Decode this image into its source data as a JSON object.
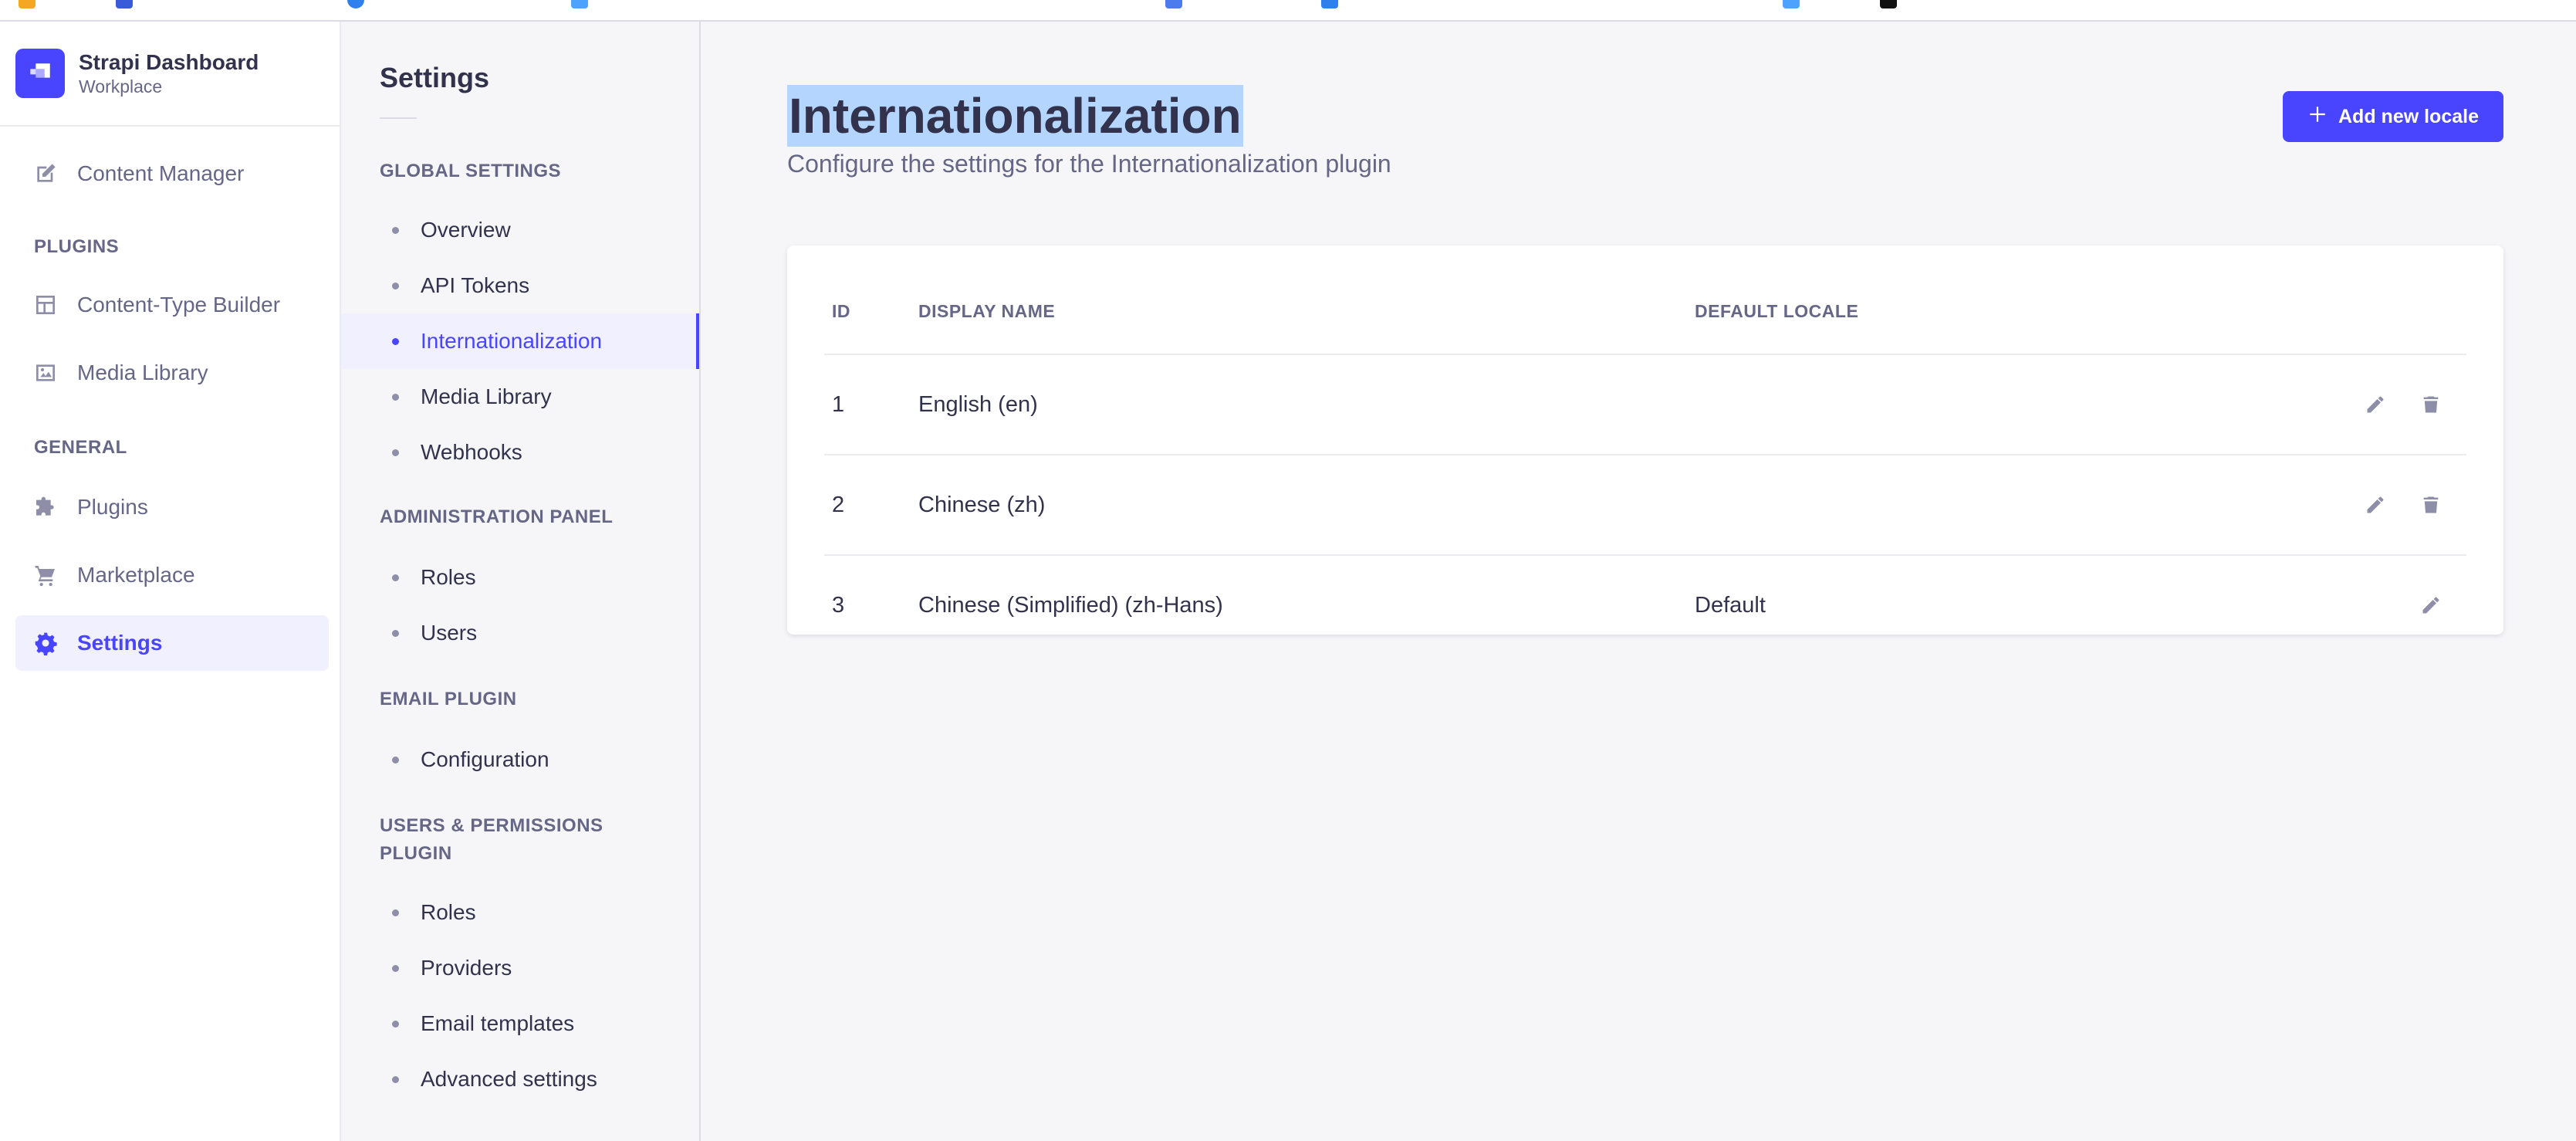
{
  "brand": {
    "title": "Strapi Dashboard",
    "subtitle": "Workplace",
    "accent": "#4945ff"
  },
  "mainnav": {
    "content_manager": "Content Manager",
    "plugins_section": "PLUGINS",
    "content_type_builder": "Content-Type Builder",
    "media_library": "Media Library",
    "general_section": "GENERAL",
    "plugins": "Plugins",
    "marketplace": "Marketplace",
    "settings": "Settings"
  },
  "subnav": {
    "title": "Settings",
    "global_section": "GLOBAL SETTINGS",
    "global_items": [
      "Overview",
      "API Tokens",
      "Internationalization",
      "Media Library",
      "Webhooks"
    ],
    "admin_section": "ADMINISTRATION PANEL",
    "admin_items": [
      "Roles",
      "Users"
    ],
    "email_section": "EMAIL PLUGIN",
    "email_items": [
      "Configuration"
    ],
    "users_section": "USERS & PERMISSIONS PLUGIN",
    "users_items": [
      "Roles",
      "Providers",
      "Email templates",
      "Advanced settings"
    ]
  },
  "page": {
    "title": "Internationalization",
    "subtitle": "Configure the settings for the Internationalization plugin",
    "add_button": "Add new locale"
  },
  "table": {
    "headers": {
      "id": "ID",
      "display_name": "DISPLAY NAME",
      "default_locale": "DEFAULT LOCALE"
    },
    "rows": [
      {
        "id": "1",
        "display_name": "English (en)",
        "default_locale": ""
      },
      {
        "id": "2",
        "display_name": "Chinese (zh)",
        "default_locale": ""
      },
      {
        "id": "3",
        "display_name": "Chinese (Simplified) (zh-Hans)",
        "default_locale": "Default"
      }
    ]
  },
  "icons": {
    "edit": "pencil-icon",
    "delete": "trash-icon",
    "add": "plus-icon"
  }
}
